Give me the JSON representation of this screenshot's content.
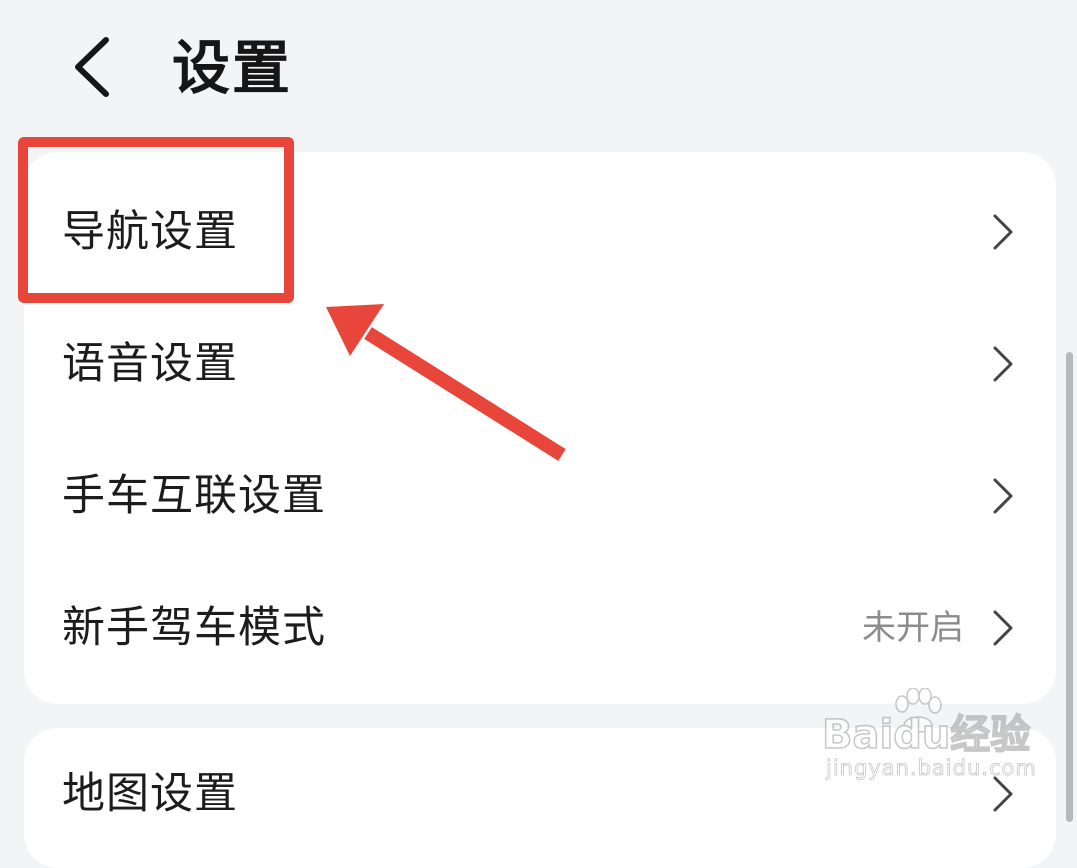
{
  "header": {
    "title": "设置",
    "back_icon": "chevron-left-icon"
  },
  "settings_group_1": {
    "items": [
      {
        "label": "导航设置",
        "value": "",
        "icon": "chevron-right-icon"
      },
      {
        "label": "语音设置",
        "value": "",
        "icon": "chevron-right-icon"
      },
      {
        "label": "手车互联设置",
        "value": "",
        "icon": "chevron-right-icon"
      },
      {
        "label": "新手驾车模式",
        "value": "未开启",
        "icon": "chevron-right-icon"
      }
    ]
  },
  "settings_group_2": {
    "items": [
      {
        "label": "地图设置",
        "value": "",
        "icon": "chevron-right-icon"
      }
    ]
  },
  "annotation": {
    "highlight_color": "#e8463a",
    "target": "导航设置"
  },
  "watermark": {
    "logo_text": "Baidu经验",
    "url_text": "jingyan.baidu.com"
  },
  "colors": {
    "background": "#f3f4f6",
    "card": "#ffffff",
    "text_primary": "#1c1c1c",
    "text_secondary": "#8c8c8c",
    "annotation": "#e8463a"
  }
}
